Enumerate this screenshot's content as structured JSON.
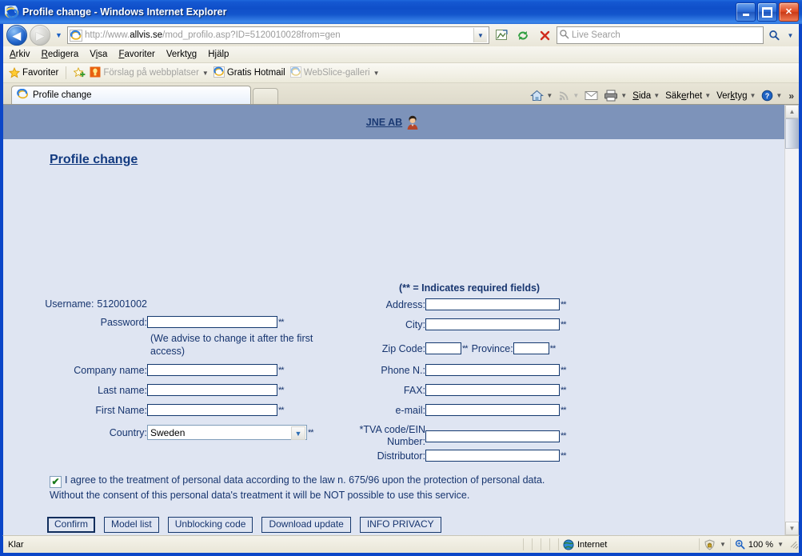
{
  "window": {
    "title": "Profile change - Windows Internet Explorer",
    "minimize_label": "Minimize",
    "maximize_label": "Maximize",
    "close_label": "Close"
  },
  "toolbar": {
    "back_label": "Back",
    "forward_label": "Forward",
    "history_label": "Recent Pages",
    "url_prefix": "http://www.",
    "url_domain": "allvis.se",
    "url_suffix": "/mod_profilo.asp?ID=5120010028from=gen",
    "url_full": "http://www.allvis.se/mod_profilo.asp?ID=5120010028from=gen",
    "compat_label": "Compatibility View",
    "refresh_label": "Refresh",
    "stop_label": "Stop",
    "search_placeholder": "Live Search",
    "search_value": "",
    "search_go_label": "Search",
    "search_provider_label": "Search Options"
  },
  "menubar": {
    "items": [
      {
        "label": "Arkiv",
        "accel": "A"
      },
      {
        "label": "Redigera",
        "accel": "R"
      },
      {
        "label": "Visa",
        "accel": "i"
      },
      {
        "label": "Favoriter",
        "accel": "F"
      },
      {
        "label": "Verktyg",
        "accel": "y"
      },
      {
        "label": "Hjälp",
        "accel": "j"
      }
    ]
  },
  "favbar": {
    "favorites_label": "Favoriter",
    "items": [
      {
        "label": "Förslag på webbplatser",
        "dim": true,
        "caret": true
      },
      {
        "label": "Gratis Hotmail",
        "dim": false,
        "caret": false
      },
      {
        "label": "WebSlice-galleri",
        "dim": true,
        "caret": true
      }
    ]
  },
  "tabs": {
    "active": "Profile change",
    "new_tab_label": "New Tab"
  },
  "command_bar": {
    "home_label": "Home",
    "feeds_label": "Feeds",
    "mail_label": "Read Mail",
    "print_label": "Print",
    "items": [
      {
        "label": "Sida",
        "accel": "S"
      },
      {
        "label": "Säkerhet",
        "accel": "e"
      },
      {
        "label": "Verktyg",
        "accel": "k"
      }
    ],
    "help_label": "Help",
    "overflow_label": "More"
  },
  "page": {
    "banner_link": "JNE AB",
    "heading": "Profile change",
    "required_note": "(** = Indicates required fields)",
    "required_mark": "**",
    "username_label": "Username:",
    "username_value": "512001002",
    "password_label": "Password:",
    "password_hint": "(We advise to change it after the first access)",
    "company_label": "Company name:",
    "lastname_label": "Last name:",
    "firstname_label": "First Name:",
    "country_label": "Country:",
    "country_value": "Sweden",
    "address_label": "Address:",
    "city_label": "City:",
    "zip_label": "Zip Code:",
    "province_label": "Province:",
    "phone_label": "Phone N.:",
    "fax_label": "FAX:",
    "email_label": "e-mail:",
    "tva_label_line1": "*TVA code/EIN",
    "tva_label_line2": "Number:",
    "distributor_label": "Distributor:",
    "consent_line1": "I agree to the treatment of personal data according to the law n. 675/96 upon the protection of personal data.",
    "consent_line2": "Without the consent of this personal data's treatment it will be NOT possible to use this service.",
    "consent_checked": true,
    "buttons": [
      {
        "label": "Confirm",
        "focused": true
      },
      {
        "label": "Model list",
        "focused": false
      },
      {
        "label": "Unblocking code",
        "focused": false
      },
      {
        "label": "Download update",
        "focused": false
      },
      {
        "label": "INFO PRIVACY",
        "focused": false
      }
    ],
    "field_values": {
      "password": "",
      "company": "",
      "lastname": "",
      "firstname": "",
      "address": "",
      "city": "",
      "zip": "",
      "province": "",
      "phone": "",
      "fax": "",
      "email": "",
      "tva": "",
      "distributor": ""
    }
  },
  "statusbar": {
    "status": "Klar",
    "zone": "Internet",
    "protected_label": "Protected Mode",
    "zoom": "100 %"
  },
  "colors": {
    "title_blue": "#0b46c8",
    "page_bg": "#dfe5f2",
    "banner_blue": "#7d93ba",
    "form_text": "#17356f",
    "link_blue": "#123a80"
  }
}
